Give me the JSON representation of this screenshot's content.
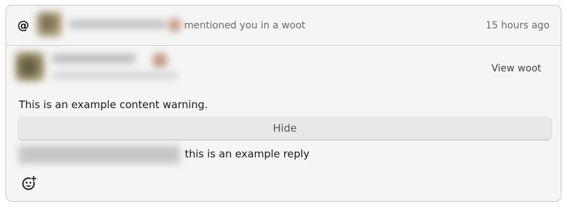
{
  "notification": {
    "icon": "at-icon",
    "action_text": "mentioned you in a woot",
    "time": "15 hours ago"
  },
  "post": {
    "view_label": "View woot",
    "content_warning": "This is an example content warning.",
    "hide_label": "Hide",
    "reply_text": "this is an example reply",
    "reaction_icon": "add-reaction-icon"
  }
}
